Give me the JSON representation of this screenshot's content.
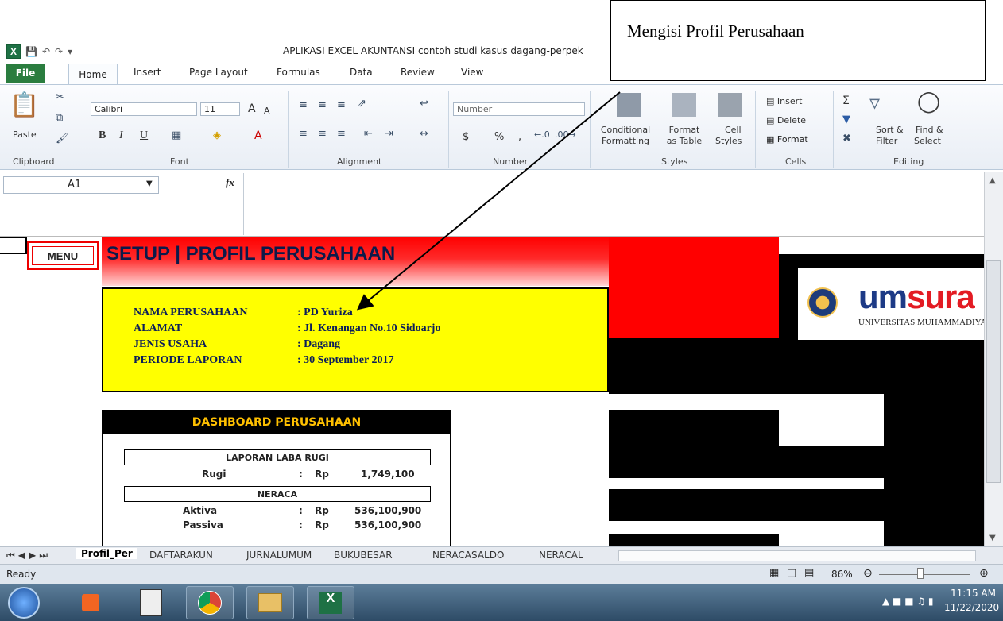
{
  "window": {
    "title": "APLIKASI EXCEL AKUNTANSI contoh studi kasus dagang-perpek",
    "app_icon": "X",
    "qat_icons": [
      "save-icon",
      "undo-icon",
      "redo-icon",
      "customize-icon"
    ]
  },
  "ribbon": {
    "tabs": [
      "File",
      "Home",
      "Insert",
      "Page Layout",
      "Formulas",
      "Data",
      "Review",
      "View"
    ],
    "clipboard": {
      "paste": "Paste",
      "label": "Clipboard"
    },
    "font": {
      "name": "Calibri",
      "size": "11",
      "label": "Font",
      "bold": "B",
      "italic": "I",
      "underline": "U",
      "grow": "A",
      "shrink": "A",
      "color": "A"
    },
    "alignment": {
      "label": "Alignment"
    },
    "number": {
      "format": "Number",
      "currency": "$",
      "percent": "%",
      "comma": ",",
      "label": "Number"
    },
    "styles": {
      "conditional": [
        "Conditional",
        "Formatting"
      ],
      "format_table": [
        "Format",
        "as Table"
      ],
      "cell_styles": [
        "Cell",
        "Styles"
      ],
      "label": "Styles"
    },
    "cells": {
      "insert": "Insert",
      "delete": "Delete",
      "format": "Format",
      "label": "Cells"
    },
    "editing": {
      "sort": [
        "Sort &",
        "Filter"
      ],
      "find": [
        "Find &",
        "Select"
      ],
      "label": "Editing",
      "sigma": "Σ"
    }
  },
  "formula_bar": {
    "name_box": "A1",
    "fx": "fx",
    "value": ""
  },
  "sheet": {
    "menu_label": "MENU",
    "title": "SETUP | PROFIL PERUSAHAAN",
    "profile": [
      {
        "label": "NAMA PERUSAHAAN",
        "value": ": PD Yuriza"
      },
      {
        "label": "ALAMAT",
        "value": ": Jl. Kenangan No.10 Sidoarjo"
      },
      {
        "label": "JENIS USAHA",
        "value": ": Dagang"
      },
      {
        "label": "PERIODE LAPORAN",
        "value": ": 30 September 2017"
      }
    ],
    "dashboard": {
      "title": "DASHBOARD PERUSAHAAN",
      "laba_rugi_header": "LAPORAN LABA RUGI",
      "rugi": {
        "label": "Rugi",
        "sep": ":",
        "cur": "Rp",
        "value": "1,749,100"
      },
      "neraca_header": "NERACA",
      "aktiva": {
        "label": "Aktiva",
        "sep": ":",
        "cur": "Rp",
        "value": "536,100,900"
      },
      "passiva": {
        "label": "Passiva",
        "sep": ":",
        "cur": "Rp",
        "value": "536,100,900"
      }
    },
    "logo": {
      "text_a": "um",
      "text_b": "sura",
      "subtitle": "UNIVERSITAS MUHAMMADIYAH"
    }
  },
  "sheet_tabs": [
    "Profil_Per",
    "DAFTARAKUN",
    "JURNALUMUM",
    "BUKUBESAR",
    "NERACASALDO",
    "NERACAL"
  ],
  "status": {
    "ready": "Ready",
    "zoom": "86%"
  },
  "taskbar": {
    "time": "11:15 AM",
    "date": "11/22/2020"
  },
  "callout": {
    "text": "Mengisi Profil Perusahaan"
  }
}
